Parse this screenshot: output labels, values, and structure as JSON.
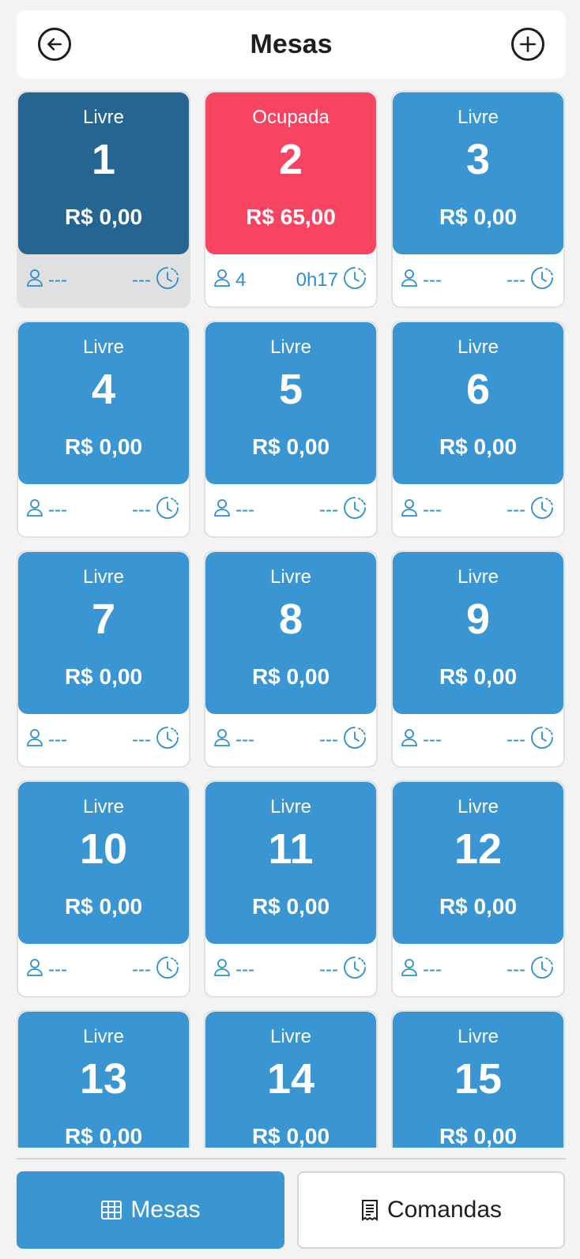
{
  "header": {
    "title": "Mesas"
  },
  "colors": {
    "livre": "#3a96d3",
    "livre_selected": "#256591",
    "ocupada": "#f74461",
    "accent_text": "#2b8fd0"
  },
  "tables": [
    {
      "status": "Livre",
      "number": "1",
      "price": "R$ 0,00",
      "people": "---",
      "time": "---",
      "state": "selected"
    },
    {
      "status": "Ocupada",
      "number": "2",
      "price": "R$ 65,00",
      "people": "4",
      "time": "0h17",
      "state": "ocupada"
    },
    {
      "status": "Livre",
      "number": "3",
      "price": "R$ 0,00",
      "people": "---",
      "time": "---",
      "state": "livre"
    },
    {
      "status": "Livre",
      "number": "4",
      "price": "R$ 0,00",
      "people": "---",
      "time": "---",
      "state": "livre"
    },
    {
      "status": "Livre",
      "number": "5",
      "price": "R$ 0,00",
      "people": "---",
      "time": "---",
      "state": "livre"
    },
    {
      "status": "Livre",
      "number": "6",
      "price": "R$ 0,00",
      "people": "---",
      "time": "---",
      "state": "livre"
    },
    {
      "status": "Livre",
      "number": "7",
      "price": "R$ 0,00",
      "people": "---",
      "time": "---",
      "state": "livre"
    },
    {
      "status": "Livre",
      "number": "8",
      "price": "R$ 0,00",
      "people": "---",
      "time": "---",
      "state": "livre"
    },
    {
      "status": "Livre",
      "number": "9",
      "price": "R$ 0,00",
      "people": "---",
      "time": "---",
      "state": "livre"
    },
    {
      "status": "Livre",
      "number": "10",
      "price": "R$ 0,00",
      "people": "---",
      "time": "---",
      "state": "livre"
    },
    {
      "status": "Livre",
      "number": "11",
      "price": "R$ 0,00",
      "people": "---",
      "time": "---",
      "state": "livre"
    },
    {
      "status": "Livre",
      "number": "12",
      "price": "R$ 0,00",
      "people": "---",
      "time": "---",
      "state": "livre"
    },
    {
      "status": "Livre",
      "number": "13",
      "price": "R$ 0,00",
      "people": "---",
      "time": "---",
      "state": "livre"
    },
    {
      "status": "Livre",
      "number": "14",
      "price": "R$ 0,00",
      "people": "---",
      "time": "---",
      "state": "livre"
    },
    {
      "status": "Livre",
      "number": "15",
      "price": "R$ 0,00",
      "people": "---",
      "time": "---",
      "state": "livre"
    }
  ],
  "footer": {
    "mesas_label": "Mesas",
    "comandas_label": "Comandas",
    "active_tab": "mesas"
  }
}
